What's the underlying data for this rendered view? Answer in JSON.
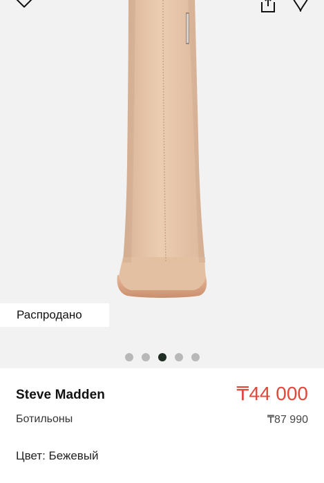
{
  "gallery": {
    "badge": "Распродано",
    "image": "beige suede ankle boot, front view",
    "slide_count": 5,
    "active_slide": 3,
    "icons": {
      "left": "heart-outline-icon",
      "share": "share-icon",
      "favorite": "heart-outline-icon"
    }
  },
  "product": {
    "brand": "Steve Madden",
    "category": "Ботильоны",
    "price": "₸44 000",
    "old_price": "₸87 990",
    "color_label": "Цвет: Бежевый"
  },
  "colors": {
    "sale_price": "#e0483c",
    "active_dot": "#1f2d24",
    "inactive_dot": "#b8b8b8",
    "gallery_bg": "#f2f2f2"
  }
}
